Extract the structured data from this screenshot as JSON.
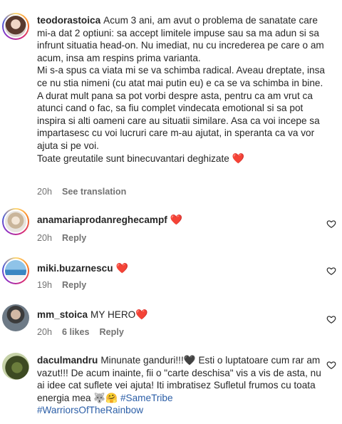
{
  "comments": [
    {
      "username": "teodorastoica",
      "paragraphs": [
        "Acum 3 ani, am avut o problema de sanatate care mi-a dat 2 optiuni: sa accept limitele impuse sau sa ma adun si sa infrunt situatia head-on. Nu imediat, nu cu increderea pe care o am acum, insa am respins prima varianta.",
        "Mi s-a spus ca viata mi se va schimba radical. Aveau dreptate, insa ce nu stia nimeni (cu atat mai putin eu) e ca se va schimba in bine.",
        "A durat mult pana sa pot vorbi despre asta, pentru ca am vrut ca atunci cand o fac, sa fiu complet vindecata emotional si sa pot inspira si alti oameni care au situatii similare. Asa ca voi incepe sa impartasesc cu voi lucruri care m-au ajutat, in speranta ca va vor ajuta si pe voi.",
        "Toate greutatile sunt binecuvantari deghizate"
      ],
      "emoji": "❤️",
      "time": "20h",
      "action": "See translation"
    },
    {
      "username": "anamariaprodanreghecampf",
      "text": "",
      "emoji": "❤️",
      "time": "20h",
      "action": "Reply"
    },
    {
      "username": "miki.buzarnescu",
      "text": "",
      "emoji": "❤️",
      "time": "19h",
      "action": "Reply"
    },
    {
      "username": "mm_stoica",
      "text": "MY HERO",
      "emoji": "❤️",
      "time": "20h",
      "likes": "6 likes",
      "action": "Reply"
    },
    {
      "username": "daculmandru",
      "text_a": "Minunate ganduri!!!",
      "emoji_a": "🖤",
      "text_b": " Esti o luptatoare cum rar am vazut!!! De acum inainte, fii o \"carte deschisa\" vis a vis de asta, nu ai idee cat suflete vei ajuta! Iti imbratisez Sufletul frumos cu toata energia mea ",
      "emoji_b": "🐺🤗",
      "hashtag1": "#SameTribe",
      "hashtag2": "#WarriorsOfTheRainbow"
    }
  ]
}
